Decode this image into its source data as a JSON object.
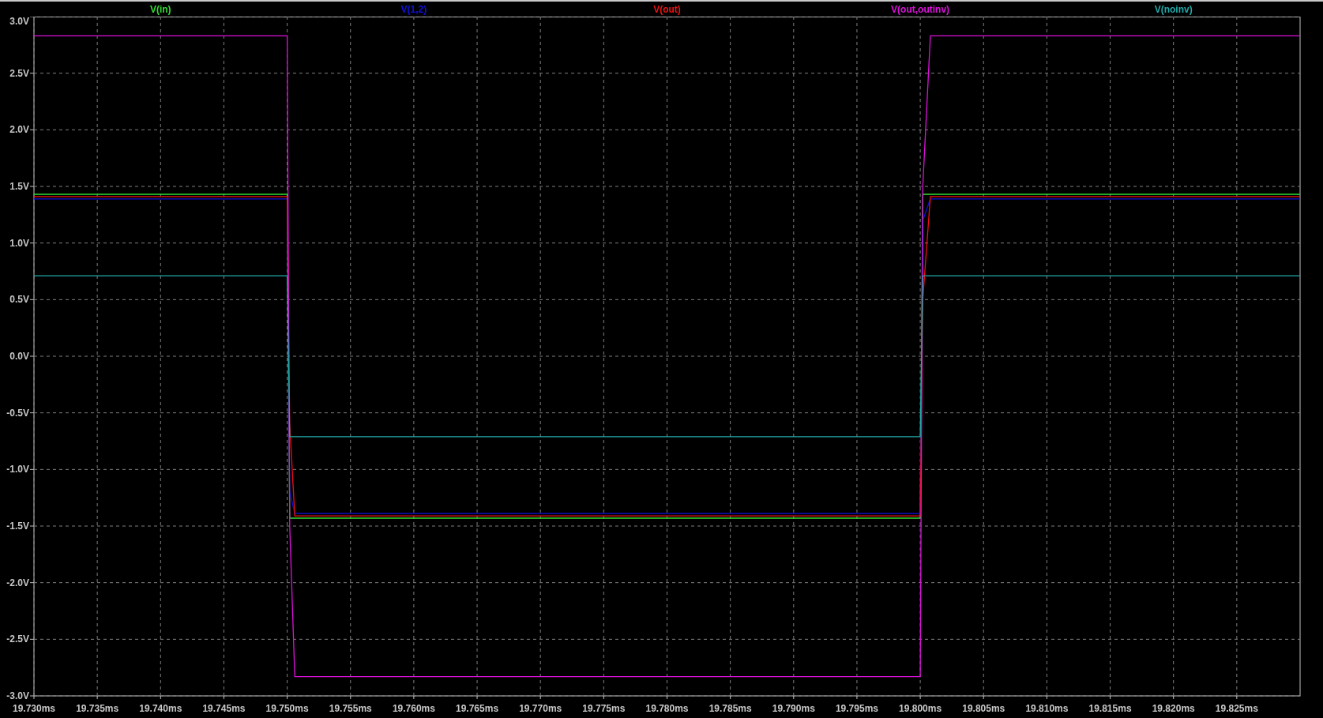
{
  "chart_data": {
    "type": "line",
    "grid": true,
    "x": [
      19.73,
      19.75,
      19.7502,
      19.7506,
      19.8,
      19.8002,
      19.8008,
      19.83
    ],
    "series": [
      {
        "name": "V(in)",
        "color": "#33dd33",
        "values": [
          1.43,
          1.43,
          -1.43,
          -1.43,
          -1.43,
          1.43,
          1.43,
          1.43
        ]
      },
      {
        "name": "V(1,2)",
        "color": "#1010e0",
        "values": [
          1.39,
          1.39,
          -1.2,
          -1.39,
          -1.39,
          1.2,
          1.39,
          1.39
        ]
      },
      {
        "name": "V(out)",
        "color": "#ee1111",
        "values": [
          1.41,
          1.41,
          -0.6,
          -1.41,
          -1.41,
          0.5,
          1.41,
          1.41
        ]
      },
      {
        "name": "V(out,outinv)",
        "color": "#dd11dd",
        "values": [
          2.83,
          2.83,
          -1.5,
          -2.83,
          -2.83,
          1.5,
          2.83,
          2.83
        ]
      },
      {
        "name": "V(noinv)",
        "color": "#22aaaa",
        "values": [
          0.71,
          0.71,
          -0.71,
          -0.71,
          -0.71,
          0.71,
          0.71,
          0.71
        ]
      }
    ],
    "xlim": [
      19.73,
      19.83
    ],
    "ylim": [
      -3.0,
      3.0
    ],
    "xticks": [
      {
        "value": 19.73,
        "label": "19.730ms"
      },
      {
        "value": 19.735,
        "label": "19.735ms"
      },
      {
        "value": 19.74,
        "label": "19.740ms"
      },
      {
        "value": 19.745,
        "label": "19.745ms"
      },
      {
        "value": 19.75,
        "label": "19.750ms"
      },
      {
        "value": 19.755,
        "label": "19.755ms"
      },
      {
        "value": 19.76,
        "label": "19.760ms"
      },
      {
        "value": 19.765,
        "label": "19.765ms"
      },
      {
        "value": 19.77,
        "label": "19.770ms"
      },
      {
        "value": 19.775,
        "label": "19.775ms"
      },
      {
        "value": 19.78,
        "label": "19.780ms"
      },
      {
        "value": 19.785,
        "label": "19.785ms"
      },
      {
        "value": 19.79,
        "label": "19.790ms"
      },
      {
        "value": 19.795,
        "label": "19.795ms"
      },
      {
        "value": 19.8,
        "label": "19.800ms"
      },
      {
        "value": 19.805,
        "label": "19.805ms"
      },
      {
        "value": 19.81,
        "label": "19.810ms"
      },
      {
        "value": 19.815,
        "label": "19.815ms"
      },
      {
        "value": 19.82,
        "label": "19.820ms"
      },
      {
        "value": 19.825,
        "label": "19.825ms"
      }
    ],
    "yticks": [
      {
        "value": 3.0,
        "label": "3.0V"
      },
      {
        "value": 2.5,
        "label": "2.5V"
      },
      {
        "value": 2.0,
        "label": "2.0V"
      },
      {
        "value": 1.5,
        "label": "1.5V"
      },
      {
        "value": 1.0,
        "label": "1.0V"
      },
      {
        "value": 0.5,
        "label": "0.5V"
      },
      {
        "value": 0.0,
        "label": "0.0V"
      },
      {
        "value": -0.5,
        "label": "-0.5V"
      },
      {
        "value": -1.0,
        "label": "-1.0V"
      },
      {
        "value": -1.5,
        "label": "-1.5V"
      },
      {
        "value": -2.0,
        "label": "-2.0V"
      },
      {
        "value": -2.5,
        "label": "-2.5V"
      },
      {
        "value": -3.0,
        "label": "-3.0V"
      }
    ]
  }
}
